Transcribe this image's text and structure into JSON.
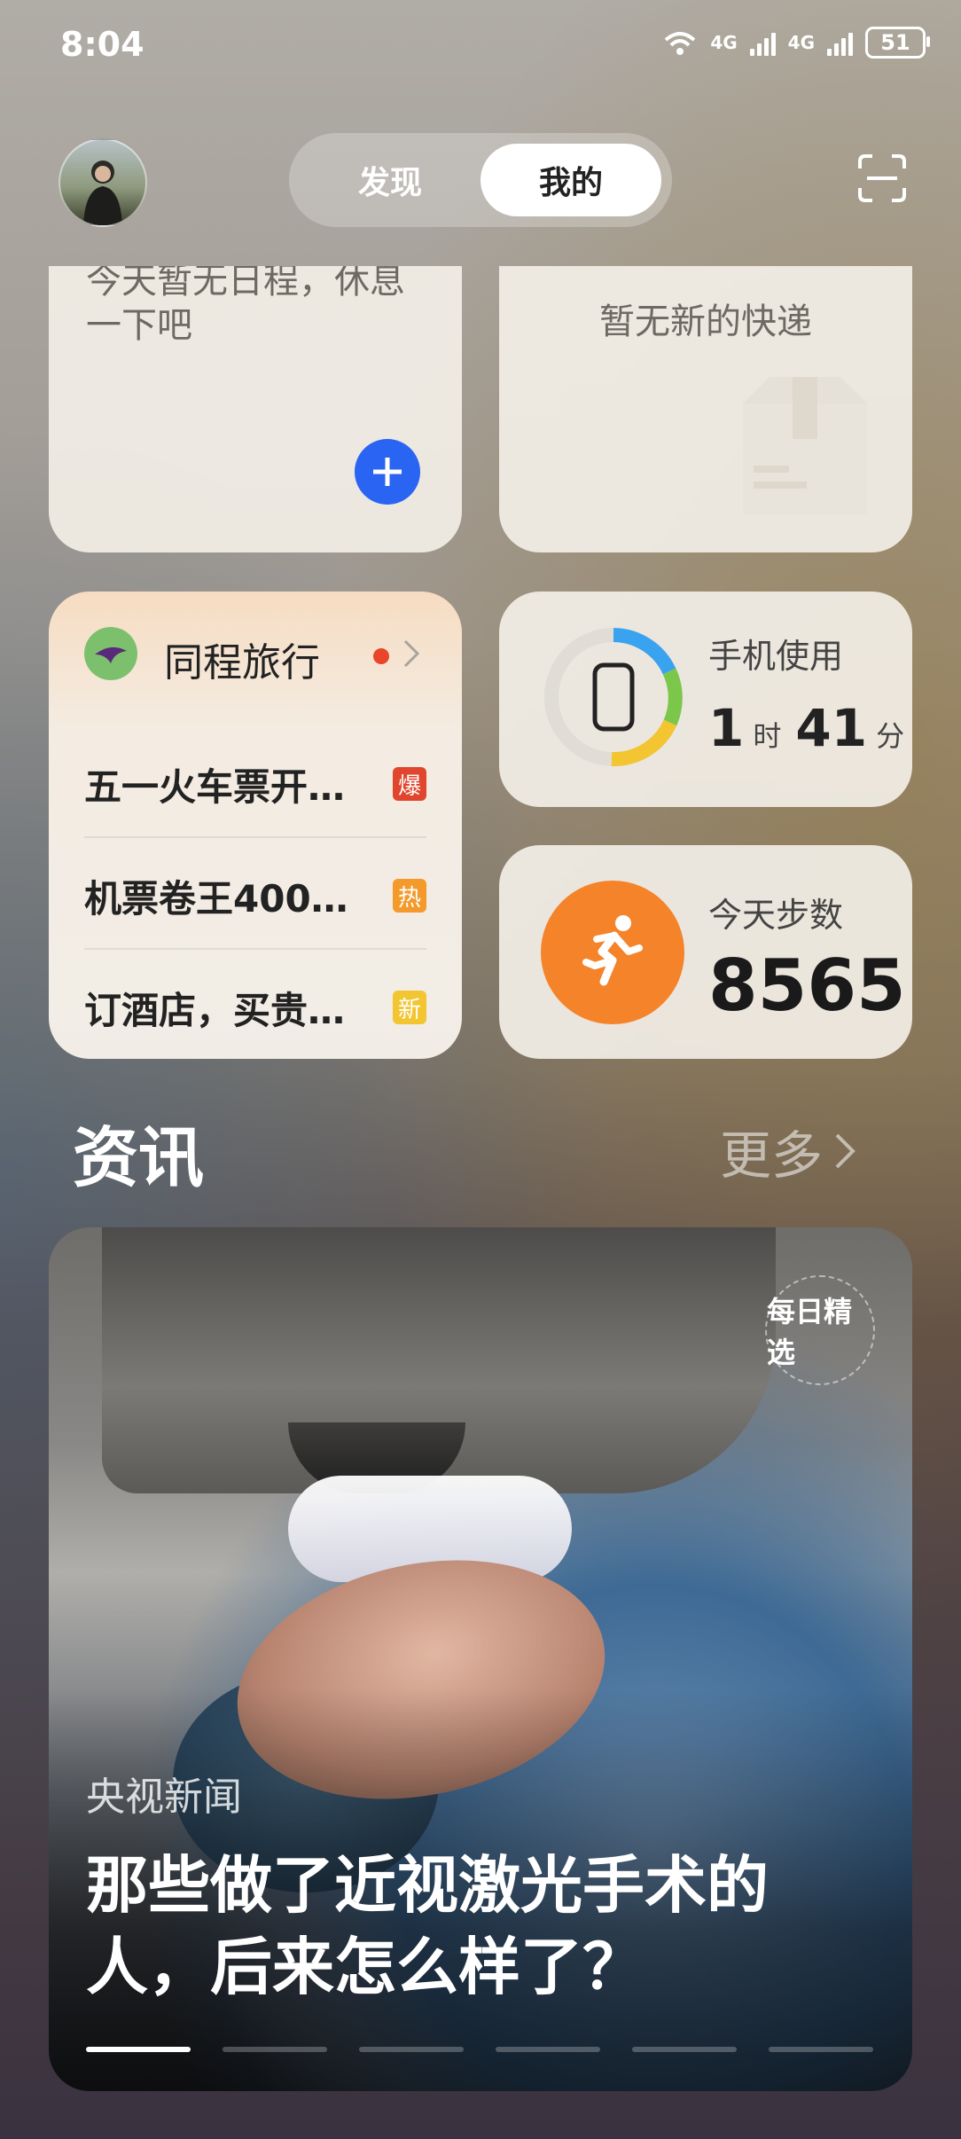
{
  "status_bar": {
    "time": "8:04",
    "net1": "4G",
    "net2": "4G",
    "wifi_small": "6",
    "battery": "51"
  },
  "header": {
    "tabs": [
      "发现",
      "我的"
    ],
    "active_tab": "我的"
  },
  "schedule_card": {
    "text": "今天暂无日程，休息一下吧"
  },
  "express_card": {
    "text": "暂无新的快递"
  },
  "travel_card": {
    "app_name": "同程旅行",
    "items": [
      {
        "title": "五一火车票开…",
        "badge": "爆",
        "badge_color": "#e0462d"
      },
      {
        "title": "机票卷王400…",
        "badge": "热",
        "badge_color": "#f39a2b"
      },
      {
        "title": "订酒店，买贵…",
        "badge": "新",
        "badge_color": "#f2c531"
      }
    ]
  },
  "usage_card": {
    "title": "手机使用",
    "hours": "1",
    "hours_unit": "时",
    "minutes": "41",
    "minutes_unit": "分"
  },
  "steps_card": {
    "title": "今天步数",
    "steps": "8565"
  },
  "news": {
    "section_title": "资讯",
    "more_label": "更多",
    "editor_badge": "每日精选",
    "source": "央视新闻",
    "headline": "那些做了近视激光手术的人，后来怎么样了？",
    "page_count": 6,
    "active_page": 1
  },
  "colors": {
    "accent_blue": "#2a64f2",
    "run_orange": "#f5832a"
  }
}
